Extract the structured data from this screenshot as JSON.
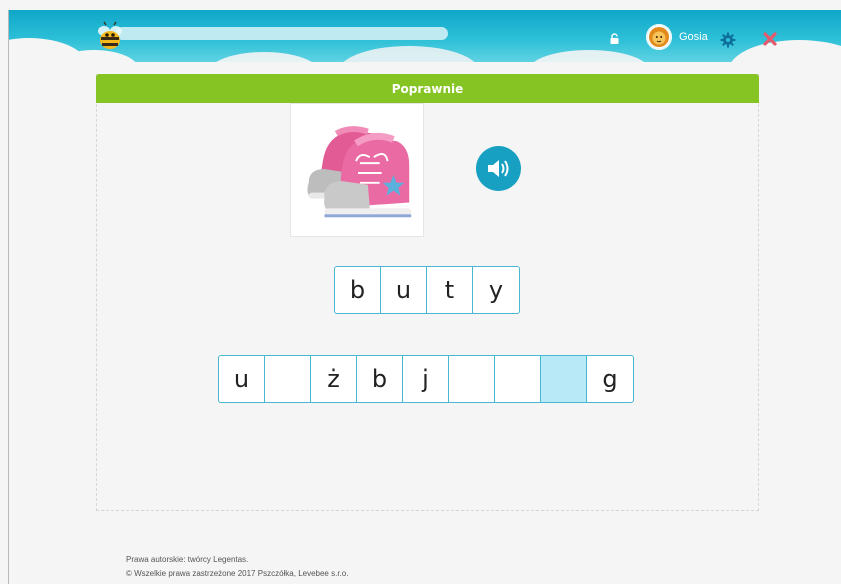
{
  "header": {
    "username": "Gosia",
    "progress": 0,
    "icons": [
      "bee-logo",
      "lock-icon",
      "avatar-lion",
      "gear-icon",
      "close-icon"
    ],
    "colors": {
      "bar": "#1bb0cf",
      "close": "#e55a6b",
      "gear": "#0e6f9a"
    }
  },
  "banner": {
    "title": "Poprawnie",
    "color": "#86c424"
  },
  "exercise": {
    "image_alt": "pink sneakers",
    "target_word": [
      "b",
      "u",
      "t",
      "y"
    ],
    "letter_pool": [
      "u",
      "",
      "ż",
      "b",
      "j",
      "",
      "",
      "",
      "g"
    ],
    "active_slot": 7
  },
  "footer": {
    "line1": "Prawa autorskie: twórcy Legentas.",
    "line2": "© Wszelkie prawa zastrzeżone 2017 Pszczółka, Levebee s.r.o."
  }
}
